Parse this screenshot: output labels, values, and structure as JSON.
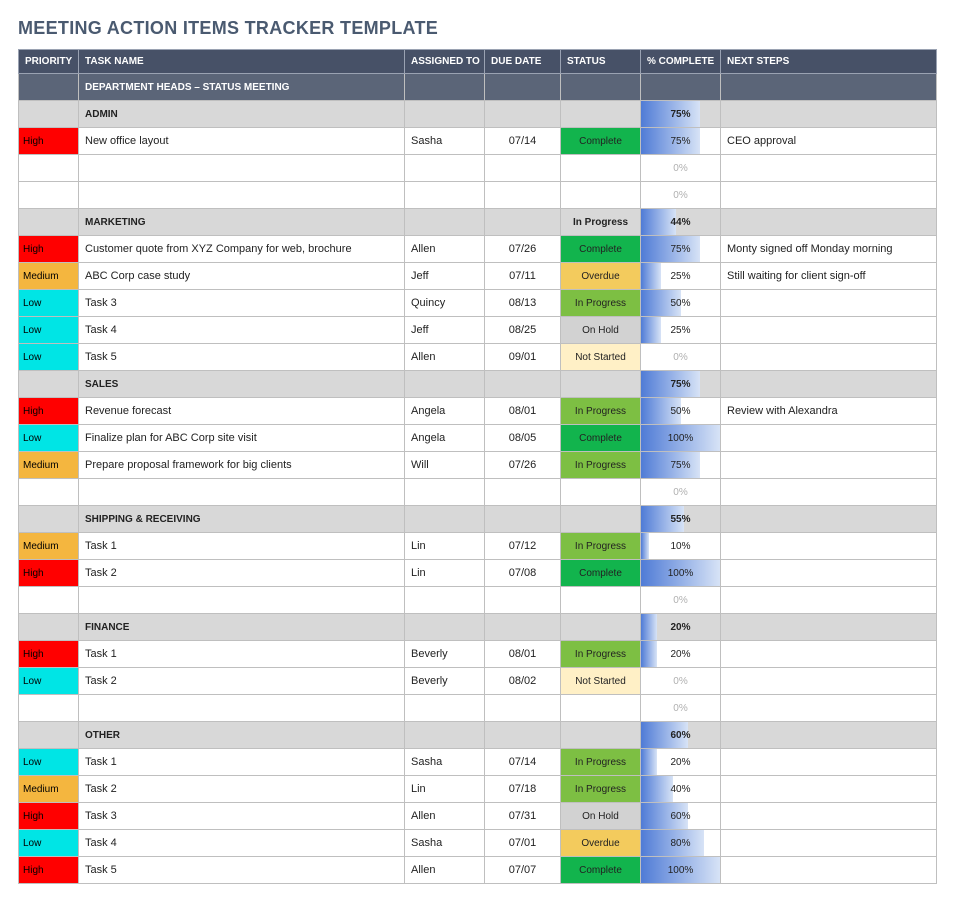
{
  "title": "MEETING ACTION ITEMS TRACKER TEMPLATE",
  "headers": {
    "priority": "PRIORITY",
    "task": "TASK NAME",
    "assigned": "ASSIGNED TO",
    "due": "DUE DATE",
    "status": "STATUS",
    "complete": "% COMPLETE",
    "next": "NEXT STEPS"
  },
  "section": {
    "title": "DEPARTMENT HEADS – STATUS MEETING"
  },
  "groups": [
    {
      "name": "ADMIN",
      "pct": 75,
      "rows": [
        {
          "priority": "High",
          "task": "New office layout",
          "assigned": "Sasha",
          "due": "07/14",
          "status": "Complete",
          "pct": 75,
          "next": "CEO approval"
        },
        {
          "priority": "",
          "task": "",
          "assigned": "",
          "due": "",
          "status": "",
          "pct": 0,
          "next": ""
        },
        {
          "priority": "",
          "task": "",
          "assigned": "",
          "due": "",
          "status": "",
          "pct": 0,
          "next": ""
        }
      ]
    },
    {
      "name": "MARKETING",
      "status": "In Progress",
      "pct": 44,
      "rows": [
        {
          "priority": "High",
          "task": "Customer quote from XYZ Company for web, brochure",
          "assigned": "Allen",
          "due": "07/26",
          "status": "Complete",
          "pct": 75,
          "next": "Monty signed off Monday morning"
        },
        {
          "priority": "Medium",
          "task": "ABC Corp case study",
          "assigned": "Jeff",
          "due": "07/11",
          "status": "Overdue",
          "pct": 25,
          "next": "Still waiting for client sign-off"
        },
        {
          "priority": "Low",
          "task": "Task 3",
          "assigned": "Quincy",
          "due": "08/13",
          "status": "In Progress",
          "pct": 50,
          "next": ""
        },
        {
          "priority": "Low",
          "task": "Task 4",
          "assigned": "Jeff",
          "due": "08/25",
          "status": "On Hold",
          "pct": 25,
          "next": ""
        },
        {
          "priority": "Low",
          "task": "Task 5",
          "assigned": "Allen",
          "due": "09/01",
          "status": "Not Started",
          "pct": 0,
          "next": ""
        }
      ]
    },
    {
      "name": "SALES",
      "pct": 75,
      "rows": [
        {
          "priority": "High",
          "task": "Revenue forecast",
          "assigned": "Angela",
          "due": "08/01",
          "status": "In Progress",
          "pct": 50,
          "next": "Review with Alexandra"
        },
        {
          "priority": "Low",
          "task": "Finalize plan for ABC Corp site visit",
          "assigned": "Angela",
          "due": "08/05",
          "status": "Complete",
          "pct": 100,
          "next": ""
        },
        {
          "priority": "Medium",
          "task": "Prepare proposal framework for big clients",
          "assigned": "Will",
          "due": "07/26",
          "status": "In Progress",
          "pct": 75,
          "next": ""
        },
        {
          "priority": "",
          "task": "",
          "assigned": "",
          "due": "",
          "status": "",
          "pct": 0,
          "next": ""
        }
      ]
    },
    {
      "name": "SHIPPING & RECEIVING",
      "pct": 55,
      "rows": [
        {
          "priority": "Medium",
          "task": "Task 1",
          "assigned": "Lin",
          "due": "07/12",
          "status": "In Progress",
          "pct": 10,
          "next": ""
        },
        {
          "priority": "High",
          "task": "Task 2",
          "assigned": "Lin",
          "due": "07/08",
          "status": "Complete",
          "pct": 100,
          "next": ""
        },
        {
          "priority": "",
          "task": "",
          "assigned": "",
          "due": "",
          "status": "",
          "pct": 0,
          "next": ""
        }
      ]
    },
    {
      "name": "FINANCE",
      "pct": 20,
      "rows": [
        {
          "priority": "High",
          "task": "Task 1",
          "assigned": "Beverly",
          "due": "08/01",
          "status": "In Progress",
          "pct": 20,
          "next": ""
        },
        {
          "priority": "Low",
          "task": "Task 2",
          "assigned": "Beverly",
          "due": "08/02",
          "status": "Not Started",
          "pct": 0,
          "next": ""
        },
        {
          "priority": "",
          "task": "",
          "assigned": "",
          "due": "",
          "status": "",
          "pct": 0,
          "next": ""
        }
      ]
    },
    {
      "name": "OTHER",
      "pct": 60,
      "rows": [
        {
          "priority": "Low",
          "task": "Task 1",
          "assigned": "Sasha",
          "due": "07/14",
          "status": "In Progress",
          "pct": 20,
          "next": ""
        },
        {
          "priority": "Medium",
          "task": "Task 2",
          "assigned": "Lin",
          "due": "07/18",
          "status": "In Progress",
          "pct": 40,
          "next": ""
        },
        {
          "priority": "High",
          "task": "Task 3",
          "assigned": "Allen",
          "due": "07/31",
          "status": "On Hold",
          "pct": 60,
          "next": ""
        },
        {
          "priority": "Low",
          "task": "Task 4",
          "assigned": "Sasha",
          "due": "07/01",
          "status": "Overdue",
          "pct": 80,
          "next": ""
        },
        {
          "priority": "High",
          "task": "Task 5",
          "assigned": "Allen",
          "due": "07/07",
          "status": "Complete",
          "pct": 100,
          "next": ""
        }
      ]
    }
  ]
}
